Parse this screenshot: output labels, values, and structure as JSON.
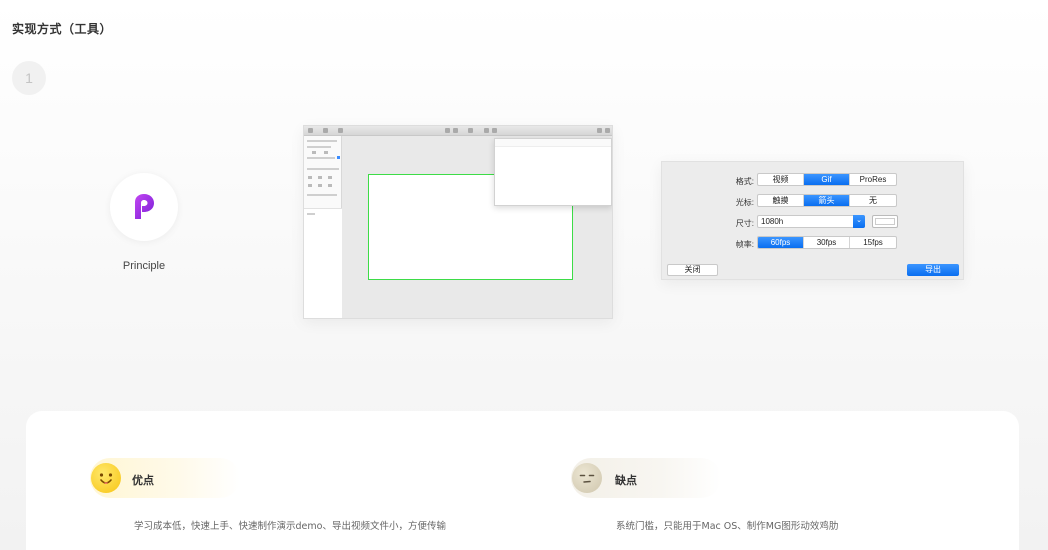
{
  "page": {
    "title": "实现方式（工具）",
    "step_number": "1"
  },
  "tool": {
    "name": "Principle",
    "brand_color": "#9b2de0"
  },
  "export_dialog": {
    "format": {
      "label": "格式:",
      "options": [
        "视频",
        "Gif",
        "ProRes"
      ],
      "selected": "Gif"
    },
    "cursor": {
      "label": "光标:",
      "options": [
        "触摸",
        "箭头",
        "无"
      ],
      "selected": "箭头"
    },
    "size": {
      "label": "尺寸:",
      "value": "1080h"
    },
    "framerate": {
      "label": "帧率:",
      "options": [
        "60fps",
        "30fps",
        "15fps"
      ],
      "selected": "60fps"
    },
    "close_label": "关闭",
    "export_label": "导出",
    "accent_color": "#0a6ef0"
  },
  "pros": {
    "title": "优点",
    "text": "学习成本低，快速上手、快速制作演示demo、导出视频文件小，方便传输"
  },
  "cons": {
    "title": "缺点",
    "text": "系统门槛，只能用于Mac OS、制作MG图形动效鸡肋"
  }
}
